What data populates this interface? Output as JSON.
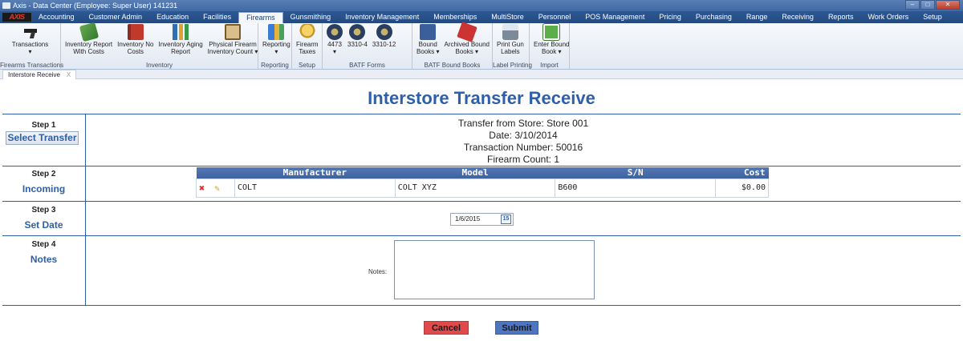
{
  "window": {
    "title": "Axis - Data Center  (Employee: Super User) 141231",
    "minimize": "–",
    "maximize": "□",
    "close": "✕"
  },
  "menubar": {
    "logo": "AXIS",
    "tabs": [
      "Accounting",
      "Customer Admin",
      "Education",
      "Facilities",
      "Firearms",
      "Gunsmithing",
      "Inventory Management",
      "Memberships",
      "MultiStore",
      "Personnel",
      "POS Management",
      "Pricing",
      "Purchasing",
      "Range",
      "Receiving",
      "Reports",
      "Work Orders",
      "Setup"
    ],
    "active": "Firearms"
  },
  "ribbon": {
    "groups": [
      {
        "label": "Firearms Transactions",
        "buttons": [
          {
            "label": "Transactions\n▾",
            "icon": "pistol-icon"
          }
        ]
      },
      {
        "label": "Inventory",
        "buttons": [
          {
            "label": "Inventory Report\nWith Costs",
            "icon": "money-icon"
          },
          {
            "label": "Inventory No\nCosts",
            "icon": "book-icon"
          },
          {
            "label": "Inventory Aging\nReport",
            "icon": "bar-chart-icon"
          },
          {
            "label": "Physical Firearm\nInventory Count ▾",
            "icon": "clipboard-icon"
          }
        ]
      },
      {
        "label": "Reporting",
        "buttons": [
          {
            "label": "Reporting\n▾",
            "icon": "report-icon"
          }
        ]
      },
      {
        "label": "Setup",
        "buttons": [
          {
            "label": "Firearm\nTaxes",
            "icon": "coins-icon"
          }
        ]
      },
      {
        "label": "BATF Forms",
        "buttons": [
          {
            "label": "4473\n▾",
            "icon": "batf-seal-icon"
          },
          {
            "label": "3310-4",
            "icon": "batf-seal-icon"
          },
          {
            "label": "3310-12",
            "icon": "batf-seal-icon"
          }
        ]
      },
      {
        "label": "BATF Bound Books",
        "buttons": [
          {
            "label": "Bound\nBooks ▾",
            "icon": "bound-book-icon"
          },
          {
            "label": "Archived Bound\nBooks ▾",
            "icon": "archive-stamp-icon"
          }
        ]
      },
      {
        "label": "Label Printing",
        "buttons": [
          {
            "label": "Print Gun\nLabels",
            "icon": "printer-icon"
          }
        ]
      },
      {
        "label": "Import",
        "buttons": [
          {
            "label": "Enter Bound\nBook ▾",
            "icon": "enter-book-icon"
          }
        ]
      }
    ]
  },
  "doc_tab": {
    "label": "Interstore Receive",
    "close": "X"
  },
  "page": {
    "title": "Interstore Transfer Receive"
  },
  "step1": {
    "num": "Step 1",
    "button": "Select Transfer",
    "lines": [
      "Transfer from Store: Store 001",
      "Date: 3/10/2014",
      "Transaction Number: 50016",
      "Firearm Count: 1"
    ]
  },
  "step2": {
    "num": "Step 2",
    "title": "Incoming",
    "columns": [
      "Manufacturer",
      "Model",
      "S/N",
      "Cost"
    ],
    "rows": [
      {
        "manufacturer": "COLT",
        "model": "COLT XYZ",
        "sn": "B600",
        "cost": "$0.00"
      }
    ]
  },
  "step3": {
    "num": "Step 3",
    "title": "Set Date",
    "date": "1/6/2015",
    "cal": "15"
  },
  "step4": {
    "num": "Step 4",
    "title": "Notes",
    "notes_label": "Notes:",
    "notes_value": ""
  },
  "buttons": {
    "cancel": "Cancel",
    "submit": "Submit"
  },
  "colors": {
    "accent": "#2e5fa8",
    "cancel": "#e04a4a",
    "submit": "#4e75c2",
    "menubar": "#2d5894"
  }
}
